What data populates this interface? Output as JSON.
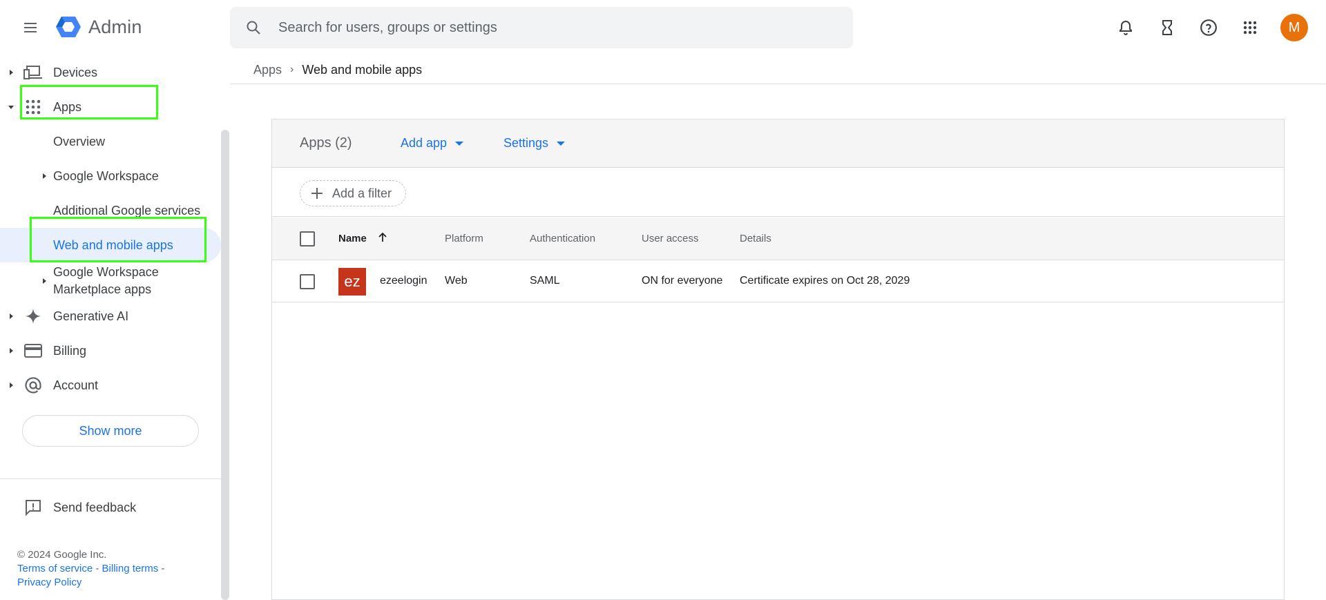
{
  "header": {
    "app_name": "Admin",
    "search_placeholder": "Search for users, groups or settings",
    "avatar_letter": "M",
    "colors": {
      "avatar_bg": "#e8710a",
      "accent": "#1a73e8"
    }
  },
  "sidebar": {
    "items": {
      "devices": "Devices",
      "apps": "Apps",
      "overview": "Overview",
      "workspace": "Google Workspace",
      "additional": "Additional Google services",
      "web_mobile": "Web and mobile apps",
      "marketplace_line1": "Google Workspace",
      "marketplace_line2": "Marketplace apps",
      "generative_ai": "Generative AI",
      "billing": "Billing",
      "account": "Account"
    },
    "show_more": "Show more",
    "send_feedback": "Send feedback",
    "footer": {
      "copyright": "© 2024 Google Inc.",
      "terms": "Terms of service",
      "billing_terms": "Billing terms",
      "privacy": "Privacy Policy",
      "sep": " - "
    }
  },
  "breadcrumb": {
    "parent": "Apps",
    "current": "Web and mobile apps"
  },
  "main": {
    "title": "Apps (2)",
    "add_app": "Add app",
    "settings": "Settings",
    "add_filter": "Add a filter",
    "columns": {
      "name": "Name",
      "platform": "Platform",
      "authentication": "Authentication",
      "user_access": "User access",
      "details": "Details"
    },
    "rows": [
      {
        "tile": "ez",
        "name": "ezeelogin",
        "platform": "Web",
        "authentication": "SAML",
        "user_access": "ON for everyone",
        "details": "Certificate expires on Oct 28, 2029",
        "tile_color": "#c5341b"
      }
    ]
  }
}
